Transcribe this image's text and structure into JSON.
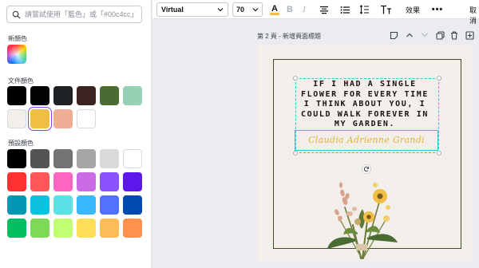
{
  "search": {
    "placeholder": "請嘗試使用「藍色」或「#00c4cc」"
  },
  "sections": {
    "new_color": "新顏色",
    "document_colors": "文件顏色",
    "default_colors": "預設顏色"
  },
  "document_colors": [
    "#000000",
    "#020202",
    "#1f2225",
    "#3b2420",
    "#4a6b32",
    "#96d1b6",
    "#f2eee9",
    "#f0bd45",
    "#edae95",
    "#ffffff"
  ],
  "default_colors": [
    "#000000",
    "#545454",
    "#737373",
    "#a6a6a6",
    "#d9d9d9",
    "#ffffff",
    "#ff3131",
    "#ff5757",
    "#ff66c4",
    "#cb6ce6",
    "#8c52ff",
    "#5e17eb",
    "#0097b2",
    "#0cc0df",
    "#5ce1e6",
    "#38b6ff",
    "#5271ff",
    "#004aad",
    "#00bf63",
    "#7ed957",
    "#c1ff72",
    "#ffde59",
    "#ffbd59",
    "#ff914d"
  ],
  "selected_color": "#f0bd45",
  "toolbar": {
    "font": "Virtual",
    "font_size": "70",
    "effects": "效果",
    "cancel": "取消"
  },
  "page": {
    "label": "第 2 頁 - 新增頁面標題",
    "quote": "IF I HAD A SINGLE FLOWER FOR EVERY TIME I THINK ABOUT YOU, I COULD WALK FOREVER IN MY GARDEN.",
    "name": "Claudia Adrienne Grandi"
  },
  "colors": {
    "accent": "#8b3dff",
    "selection": "#2ec4d3",
    "frame": "#3f4c2f",
    "name_text": "#e3b43a"
  }
}
